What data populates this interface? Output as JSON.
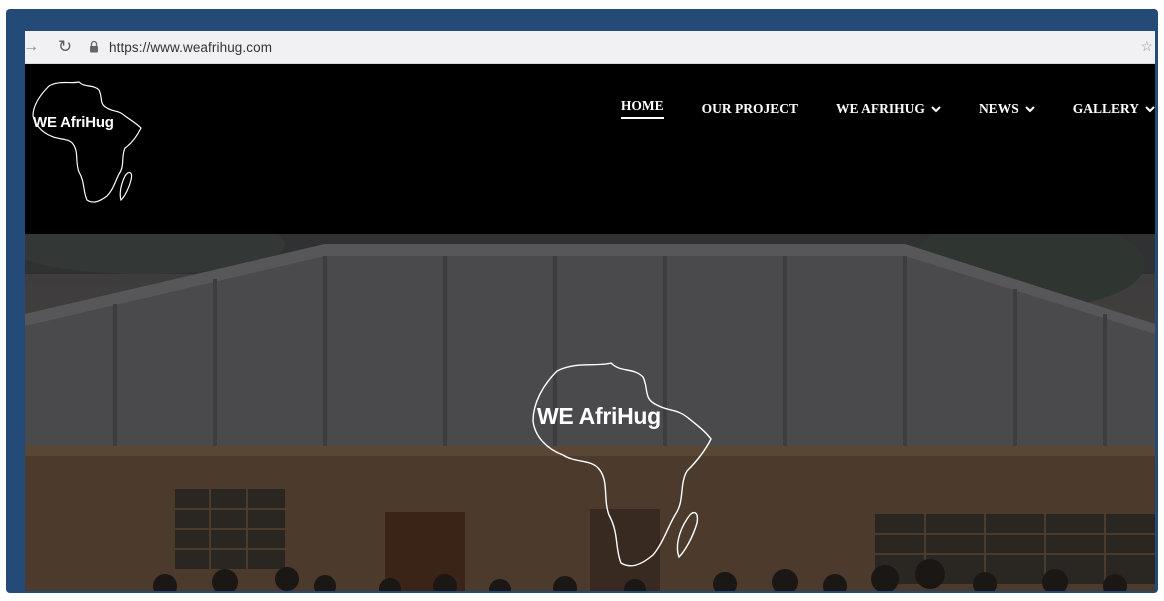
{
  "browser": {
    "url": "https://www.weafrihug.com",
    "back_icon": "arrow-right-icon",
    "reload_icon": "reload-icon",
    "lock_icon": "lock-icon",
    "bookmark_icon": "star-icon"
  },
  "site": {
    "logo_text": "WE AfriHug",
    "hero_logo_text": "WE AfriHug",
    "nav": {
      "home": "HOME",
      "our_project": "OUR PROJECT",
      "we_afrihug": "WE AFRIHUG",
      "news": "NEWS",
      "gallery": "GALLERY"
    },
    "active_nav": "HOME"
  },
  "colors": {
    "frame": "#244a78",
    "header_bg": "#000000",
    "nav_text": "#ffffff"
  }
}
